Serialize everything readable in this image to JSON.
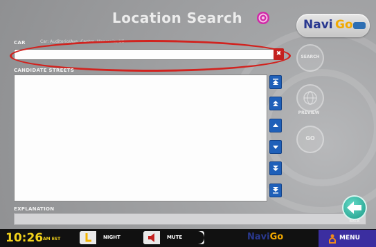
{
  "header": {
    "title": "Location Search",
    "target_icon": "target-icon"
  },
  "logo": {
    "navi": "Navi",
    "go": "Go"
  },
  "search": {
    "label": "CAR",
    "hint": "Car: Auditorio/Ave. Centro, Monrovia, US",
    "value": "",
    "clear_label": "✖"
  },
  "list": {
    "label": "CANDIDATE STREETS",
    "items": []
  },
  "scroll_buttons": [
    {
      "name": "scroll-top-button",
      "icon": "double-up-bar-icon"
    },
    {
      "name": "scroll-page-up-button",
      "icon": "double-up-icon"
    },
    {
      "name": "scroll-up-button",
      "icon": "up-icon"
    },
    {
      "name": "scroll-down-button",
      "icon": "down-icon"
    },
    {
      "name": "scroll-page-down-button",
      "icon": "double-down-icon"
    },
    {
      "name": "scroll-bottom-button",
      "icon": "double-down-bar-icon"
    }
  ],
  "side": {
    "search_label": "SEARCH",
    "preview_label": "PREVIEW",
    "go_label": "GO"
  },
  "explanation": {
    "label": "EXPLANATION",
    "value": ""
  },
  "back": {
    "label": "BACK"
  },
  "bottom_bar": {
    "time": "10:26",
    "ampm": "AM EST",
    "night_label": "NIGHT",
    "mute_label": "MUTE",
    "logo_navi": "Navi",
    "logo_go": "Go",
    "menu_label": "MENU"
  },
  "colors": {
    "accent_red": "#c3211f",
    "scroll_blue": "#1f60b9",
    "clock_yellow": "#f3d31b",
    "menu_purple": "#3b2ea0",
    "back_teal": "#1c9b88"
  }
}
